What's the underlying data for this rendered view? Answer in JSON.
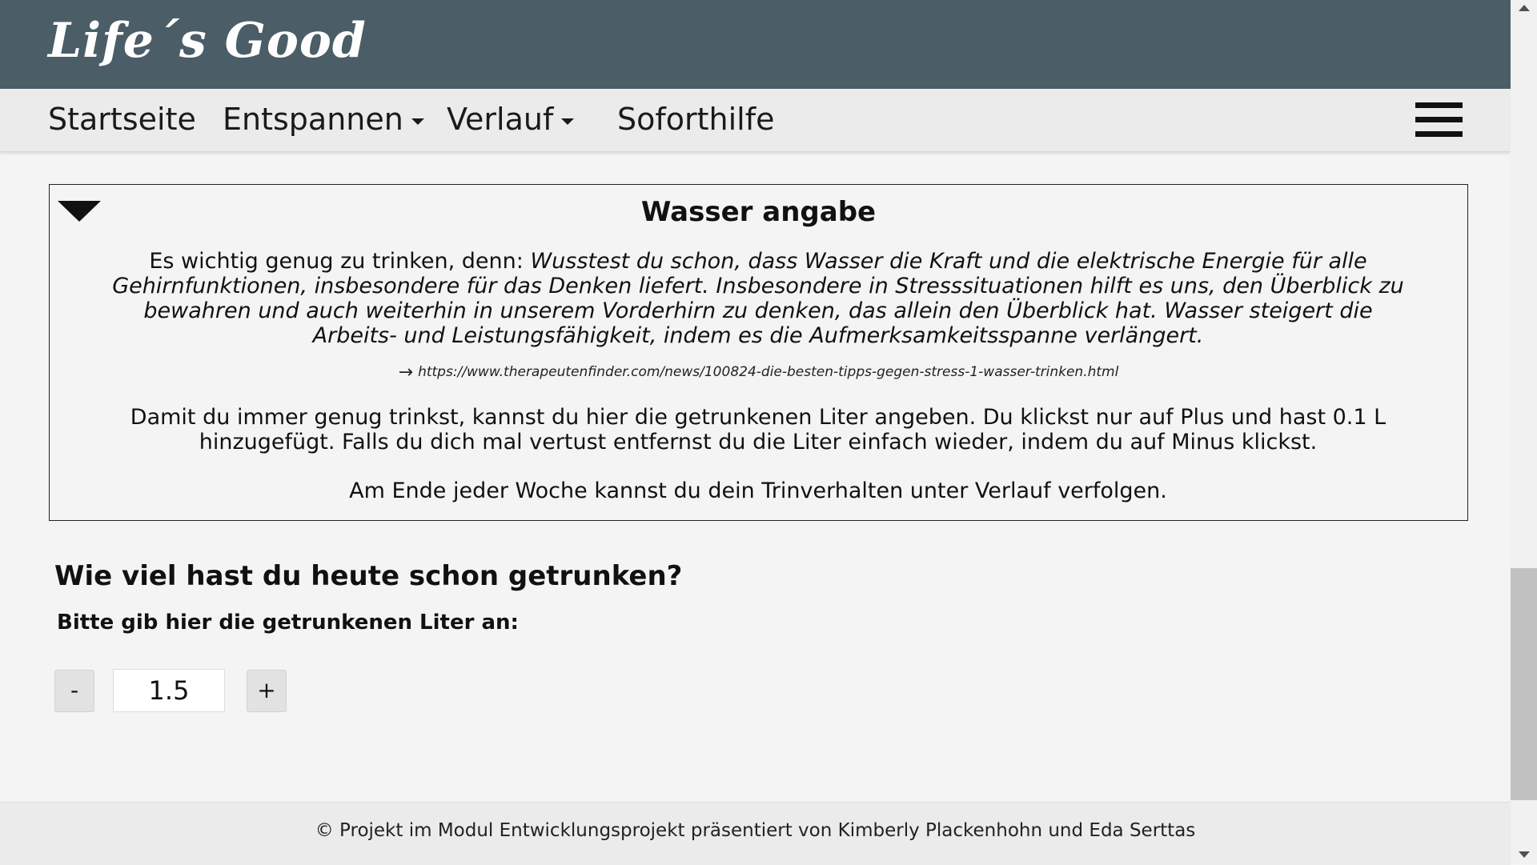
{
  "header": {
    "logo": "Life´s Good"
  },
  "nav": {
    "items": [
      {
        "label": "Startseite"
      },
      {
        "label": "Entspannen"
      },
      {
        "label": "Verlauf"
      },
      {
        "label": "Soforthilfe"
      }
    ],
    "menu_icon": "hamburger-icon"
  },
  "infobox": {
    "title": "Wasser angabe",
    "intro_lead": "Es wichtig genug zu trinken, denn: ",
    "intro_quote": "Wusstest du schon, dass Wasser die Kraft und die elektrische Energie für alle Gehirnfunktionen, insbesondere für das Denken liefert. Insbesondere in Stresssituationen hilft es uns, den Überblick zu bewahren und auch weiterhin in unserem Vorderhirn zu denken, das allein den Überblick hat. Wasser steigert die Arbeits- und Leistungsfähigkeit, indem es die Aufmerksamkeitsspanne verlängert.",
    "source_arrow": "→",
    "source_url": "https://www.therapeutenfinder.com/news/100824-die-besten-tipps-gegen-stress-1-wasser-trinken.html",
    "paragraph": "Damit du immer genug trinkst, kannst du hier die getrunkenen Liter angeben. Du klickst nur auf Plus und hast 0.1 L hinzugefügt. Falls du dich mal vertust entfernst du die Liter einfach wieder, indem du auf Minus klickst.",
    "paragraph2": "Am Ende jeder Woche kannst du dein Trinverhalten unter Verlauf verfolgen."
  },
  "tracker": {
    "question": "Wie viel hast du heute schon getrunken?",
    "prompt": "Bitte gib hier die getrunkenen Liter an:",
    "minus_label": "-",
    "plus_label": "+",
    "value": "1.5"
  },
  "footer": {
    "text": "© Projekt im Modul Entwicklungsprojekt präsentiert von Kimberly Plackenhohn und Eda Serttas"
  },
  "colors": {
    "header_bg": "#4b5d66",
    "nav_bg": "#ebebeb",
    "page_bg": "#f4f4f4"
  }
}
